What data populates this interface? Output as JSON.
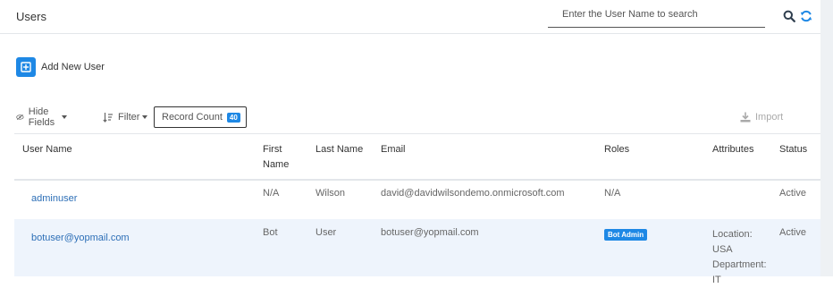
{
  "header": {
    "title": "Users",
    "search_placeholder": "Enter the User Name to search"
  },
  "icons": {
    "search": "search-icon",
    "refresh": "refresh-icon",
    "plus": "plus-square-icon",
    "eye": "eye-slash-icon",
    "filter": "sort-filter-icon",
    "import": "download-icon"
  },
  "colors": {
    "accent": "#1e88e5",
    "link": "#2d6fb7"
  },
  "actions": {
    "add_user": "Add New User"
  },
  "toolbar": {
    "hide_fields": "Hide Fields",
    "filter": "Filter",
    "record_count": "Record Count",
    "record_count_value": "40",
    "import": "Import"
  },
  "table": {
    "columns": [
      "User Name",
      "First Name",
      "Last Name",
      "Email",
      "Roles",
      "Attributes",
      "Status"
    ],
    "rows": [
      {
        "user_name": "adminuser",
        "first_name": "N/A",
        "last_name": "Wilson",
        "email": "david@davidwilsondemo.onmicrosoft.com",
        "roles": "N/A",
        "attributes": "",
        "status": "Active"
      },
      {
        "user_name": "botuser@yopmail.com",
        "first_name": "Bot",
        "last_name": "User",
        "email": "botuser@yopmail.com",
        "roles": "Bot Admin",
        "attributes": "Location: USA Department: IT",
        "status": "Active"
      }
    ]
  }
}
